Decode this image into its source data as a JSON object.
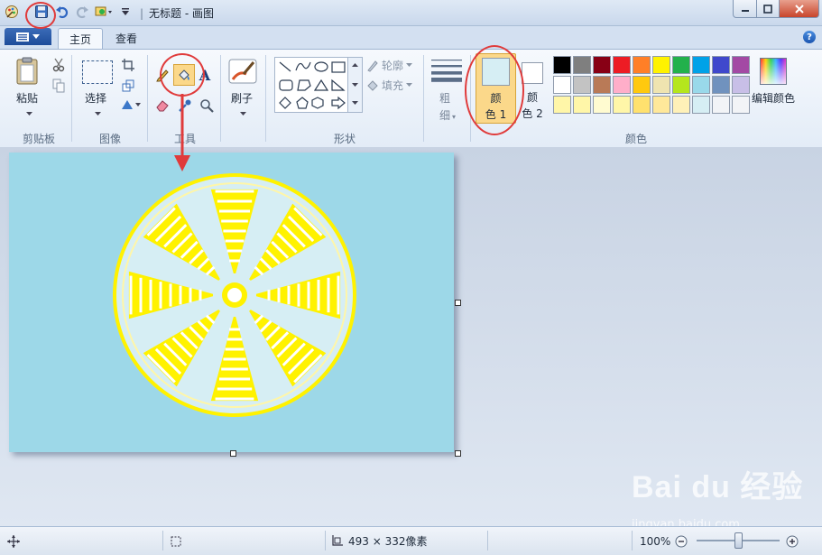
{
  "window": {
    "title": "无标题 - 画图",
    "qat_separator": "|"
  },
  "tabs": [
    {
      "label": "主页",
      "active": true
    },
    {
      "label": "查看",
      "active": false
    }
  ],
  "ribbon": {
    "clipboard": {
      "paste_label": "粘贴",
      "group_label": "剪贴板"
    },
    "image": {
      "select_label": "选择",
      "group_label": "图像"
    },
    "tools": {
      "group_label": "工具"
    },
    "brushes": {
      "label": "刷子"
    },
    "shapes": {
      "outline_label": "轮廓",
      "fill_label": "填充",
      "group_label": "形状"
    },
    "size": {
      "label_line1": "粗",
      "label_line2": "细"
    },
    "colors": {
      "color1_line1": "颜",
      "color1_line2": "色 1",
      "color2_line1": "颜",
      "color2_line2": "色 2",
      "edit_label": "编辑颜色",
      "group_label": "颜色",
      "color1_value": "#d6eef4",
      "color2_value": "#ffffff",
      "palette_row1": [
        "#000000",
        "#7f7f7f",
        "#880015",
        "#ed1c24",
        "#ff7f27",
        "#fff200",
        "#22b14c",
        "#00a2e8",
        "#3f48cc",
        "#a349a4"
      ],
      "palette_row2": [
        "#ffffff",
        "#c3c3c3",
        "#b97a57",
        "#ffaec9",
        "#ffc90e",
        "#efe4b0",
        "#b5e61d",
        "#99d9ea",
        "#7092be",
        "#c8bfe7"
      ],
      "palette_row3": [
        "#fff6a8",
        "#fff6a8",
        "#fffbd0",
        "#fff6a8",
        "#ffe16e",
        "#ffe89a",
        "#fff1b8",
        "#d6eef4",
        "#f2f4f7",
        "#f2f4f7"
      ]
    }
  },
  "status": {
    "canvas_size": "493 × 332像素",
    "zoom": "100%",
    "zoom_level": 0.5
  },
  "canvas": {
    "background": "#9dd8e8",
    "fruit_fill": "#d6eef4",
    "fruit_yellow": "#fff200"
  },
  "watermark": {
    "brand": "Bai du 经验",
    "url": "jingyan.baidu.com"
  }
}
